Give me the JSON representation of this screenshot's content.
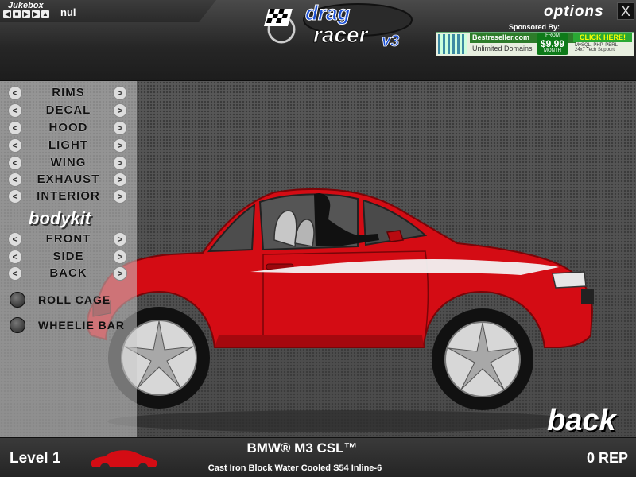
{
  "jukebox": {
    "title": "Jukebox",
    "track": "nul",
    "controls": [
      "prev-icon",
      "stop-icon",
      "play-icon",
      "next-icon",
      "up-icon"
    ]
  },
  "logo": {
    "line1": "drag",
    "line2": "racer",
    "version": "v3"
  },
  "header": {
    "options_label": "options",
    "close_label": "X"
  },
  "sponsor": {
    "label": "Sponsored By:",
    "brand": "Bestreseller.com",
    "tagline": "Unlimited Domains",
    "from": "FROM",
    "price": "$9.99",
    "month": "MONTH",
    "cta": "CLICK HERE!",
    "features": [
      "MySQL, PHP, PERL",
      "24x7 Tech Support"
    ]
  },
  "menu": {
    "parts": [
      "RIMS",
      "DECAL",
      "HOOD",
      "LIGHT",
      "WING",
      "EXHAUST",
      "INTERIOR"
    ],
    "bodykit_title": "bodykit",
    "bodykit_parts": [
      "FRONT",
      "SIDE",
      "BACK"
    ],
    "toggles": [
      "ROLL CAGE",
      "WHEELIE BAR"
    ]
  },
  "back_label": "back",
  "footer": {
    "level": "Level 1",
    "car_name": "BMW® M3 CSL™",
    "engine": "Cast Iron Block Water Cooled S54 Inline-6",
    "rep": "0 REP"
  },
  "colors": {
    "car_body": "#d40c14",
    "accent": "#1a4fd6"
  }
}
